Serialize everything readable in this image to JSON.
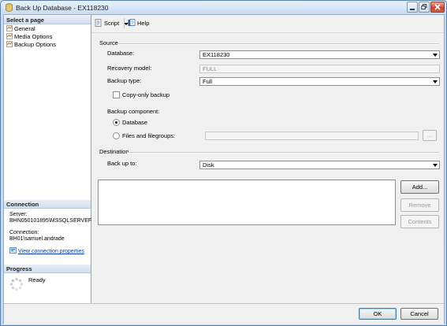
{
  "window": {
    "title": "Back Up Database - EX118230"
  },
  "left_panel": {
    "select_page_header": "Select a page",
    "pages": [
      {
        "label": "General",
        "icon": "page-icon"
      },
      {
        "label": "Media Options",
        "icon": "page-icon"
      },
      {
        "label": "Backup Options",
        "icon": "page-icon"
      }
    ],
    "connection_header": "Connection",
    "server_label": "Server:",
    "server_value": "BHN050101895\\MSSQLSERVEF",
    "connection_label": "Connection:",
    "connection_value": "BH01\\samuel.andrade",
    "view_connection_link": "View connection properties",
    "progress_header": "Progress",
    "progress_status": "Ready"
  },
  "toolbar": {
    "script_label": "Script",
    "help_label": "Help"
  },
  "source": {
    "title": "Source",
    "database_label": "Database:",
    "database_value": "EX118230",
    "recovery_model_label": "Recovery model:",
    "recovery_model_value": "FULL",
    "backup_type_label": "Backup type:",
    "backup_type_value": "Full",
    "copy_only_label": "Copy-only backup",
    "copy_only_checked": false,
    "backup_component_label": "Backup component:",
    "component_database_label": "Database",
    "component_files_label": "Files and filegroups:",
    "files_button_label": "...",
    "selected_component": "Database"
  },
  "destination": {
    "title": "Destination",
    "back_up_to_label": "Back up to:",
    "back_up_to_value": "Disk",
    "add_button": "Add...",
    "remove_button": "Remove",
    "contents_button": "Contents"
  },
  "footer": {
    "ok_button": "OK",
    "cancel_button": "Cancel"
  }
}
